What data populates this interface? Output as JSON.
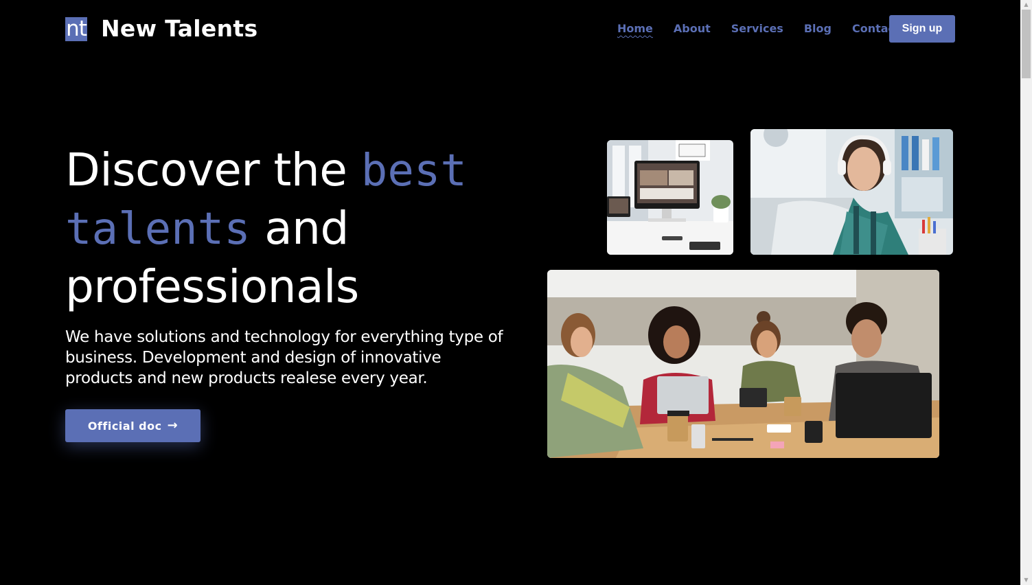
{
  "header": {
    "logo_mark": "nt",
    "brand_name": "New Talents",
    "nav": [
      {
        "label": "Home",
        "active": true
      },
      {
        "label": "About"
      },
      {
        "label": "Services"
      },
      {
        "label": "Blog"
      },
      {
        "label": "Contact"
      }
    ],
    "signup_label": "Sign up"
  },
  "hero": {
    "title_part1": "Discover the ",
    "title_accent1": "best",
    "title_accent2": "talents",
    "title_part2": " and",
    "title_part3": "professionals",
    "description": "We have solutions and technology for everything type of business. Development and design of innovative products and new products realese every year.",
    "cta_label": "Official doc",
    "cta_icon": "arrow-right-icon"
  },
  "images": [
    {
      "name": "workspace-computer-image"
    },
    {
      "name": "woman-headphones-laptop-image"
    },
    {
      "name": "team-meeting-image"
    }
  ],
  "colors": {
    "background": "#000000",
    "accent": "#5b6fb5",
    "text": "#ffffff"
  }
}
